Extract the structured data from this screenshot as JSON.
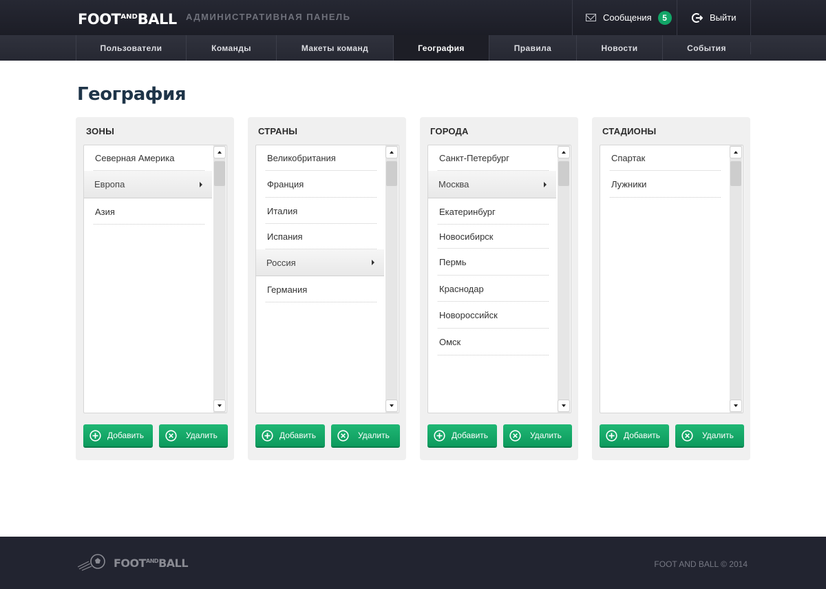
{
  "header": {
    "logo": {
      "part1": "FOOT",
      "part2": "AND",
      "part3": "BALL"
    },
    "admin_title": "АДМИНИСТРАТИВНАЯ ПАНЕЛЬ",
    "messages_label": "Сообщения",
    "messages_count": "5",
    "logout_label": "Выйти",
    "icons": {
      "messages": "envelope-icon",
      "logout": "logout-icon"
    },
    "colors": {
      "bar": "#1f2029",
      "badge": "#12a567"
    }
  },
  "nav": {
    "items": [
      {
        "label": "Пользователи"
      },
      {
        "label": "Команды"
      },
      {
        "label": "Макеты команд"
      },
      {
        "label": "География",
        "active": true
      },
      {
        "label": "Правила"
      },
      {
        "label": "Новости"
      },
      {
        "label": "События"
      }
    ]
  },
  "page": {
    "title": "География"
  },
  "panels": [
    {
      "title": "ЗОНЫ",
      "items": [
        "Северная Америка",
        "Европа",
        "Азия"
      ],
      "selected": "Европа",
      "add_label": "Добавить",
      "delete_label": "Удалить"
    },
    {
      "title": "СТРАНЫ",
      "items": [
        "Великобритания",
        "Франция",
        "Италия",
        "Испания",
        "Россия",
        "Германия"
      ],
      "selected": "Россия",
      "add_label": "Добавить",
      "delete_label": "Удалить"
    },
    {
      "title": "ГОРОДА",
      "items": [
        "Санкт-Петербург",
        "Москва",
        "Екатеринбург",
        "Новосибирск",
        "Пермь",
        "Краснодар",
        "Новороссийск",
        "Омск"
      ],
      "selected": "Москва",
      "add_label": "Добавить",
      "delete_label": "Удалить"
    },
    {
      "title": "СТАДИОНЫ",
      "items": [
        "Спартак",
        "Лужники"
      ],
      "selected": null,
      "add_label": "Добавить",
      "delete_label": "Удалить"
    }
  ],
  "button_colors": {
    "primary": "#15a869"
  },
  "footer": {
    "logo": {
      "part1": "FOOT",
      "part2": "AND",
      "part3": "BALL"
    },
    "copyright": "FOOT AND BALL © 2014"
  }
}
